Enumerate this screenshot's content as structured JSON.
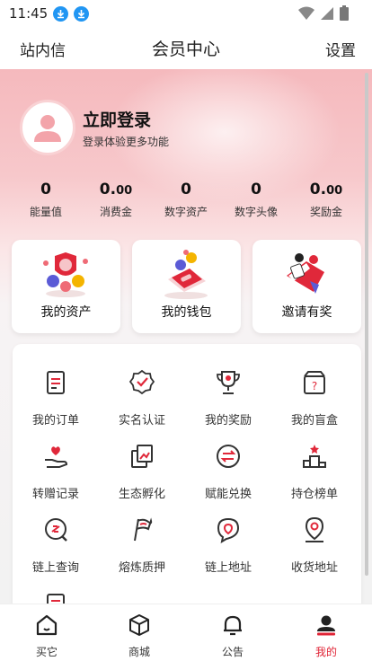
{
  "status_bar": {
    "time": "11:45"
  },
  "header": {
    "left": "站内信",
    "title": "会员中心",
    "right": "设置"
  },
  "profile": {
    "title": "立即登录",
    "subtitle": "登录体验更多功能"
  },
  "stats": [
    {
      "value": "0",
      "decimal": "",
      "label": "能量值"
    },
    {
      "value": "0.",
      "decimal": "00",
      "label": "消费金"
    },
    {
      "value": "0",
      "decimal": "",
      "label": "数字资产"
    },
    {
      "value": "0",
      "decimal": "",
      "label": "数字头像"
    },
    {
      "value": "0.",
      "decimal": "00",
      "label": "奖励金"
    }
  ],
  "cards": [
    {
      "label": "我的资产",
      "icon": "coins-icon"
    },
    {
      "label": "我的钱包",
      "icon": "wallet-phone-icon"
    },
    {
      "label": "邀请有奖",
      "icon": "invite-fan-icon"
    }
  ],
  "grid": [
    {
      "label": "我的订单",
      "icon": "order-icon"
    },
    {
      "label": "实名认证",
      "icon": "verified-icon"
    },
    {
      "label": "我的奖励",
      "icon": "trophy-icon"
    },
    {
      "label": "我的盲盒",
      "icon": "blind-box-icon"
    },
    {
      "label": "转赠记录",
      "icon": "gift-hand-icon"
    },
    {
      "label": "生态孵化",
      "icon": "incubate-icon"
    },
    {
      "label": "赋能兑换",
      "icon": "exchange-icon"
    },
    {
      "label": "持仓榜单",
      "icon": "podium-icon"
    },
    {
      "label": "链上查询",
      "icon": "chain-search-icon"
    },
    {
      "label": "熔炼质押",
      "icon": "flag-icon"
    },
    {
      "label": "链上地址",
      "icon": "location-chat-icon"
    },
    {
      "label": "收货地址",
      "icon": "pin-icon"
    }
  ],
  "tabbar": [
    {
      "label": "买它",
      "icon": "home-icon",
      "active": false
    },
    {
      "label": "商城",
      "icon": "cube-icon",
      "active": false
    },
    {
      "label": "公告",
      "icon": "bell-icon",
      "active": false
    },
    {
      "label": "我的",
      "icon": "user-icon",
      "active": true
    }
  ],
  "colors": {
    "accent": "#e02436",
    "hero_pink": "#f5b9bd",
    "background": "#f2f2f2"
  }
}
